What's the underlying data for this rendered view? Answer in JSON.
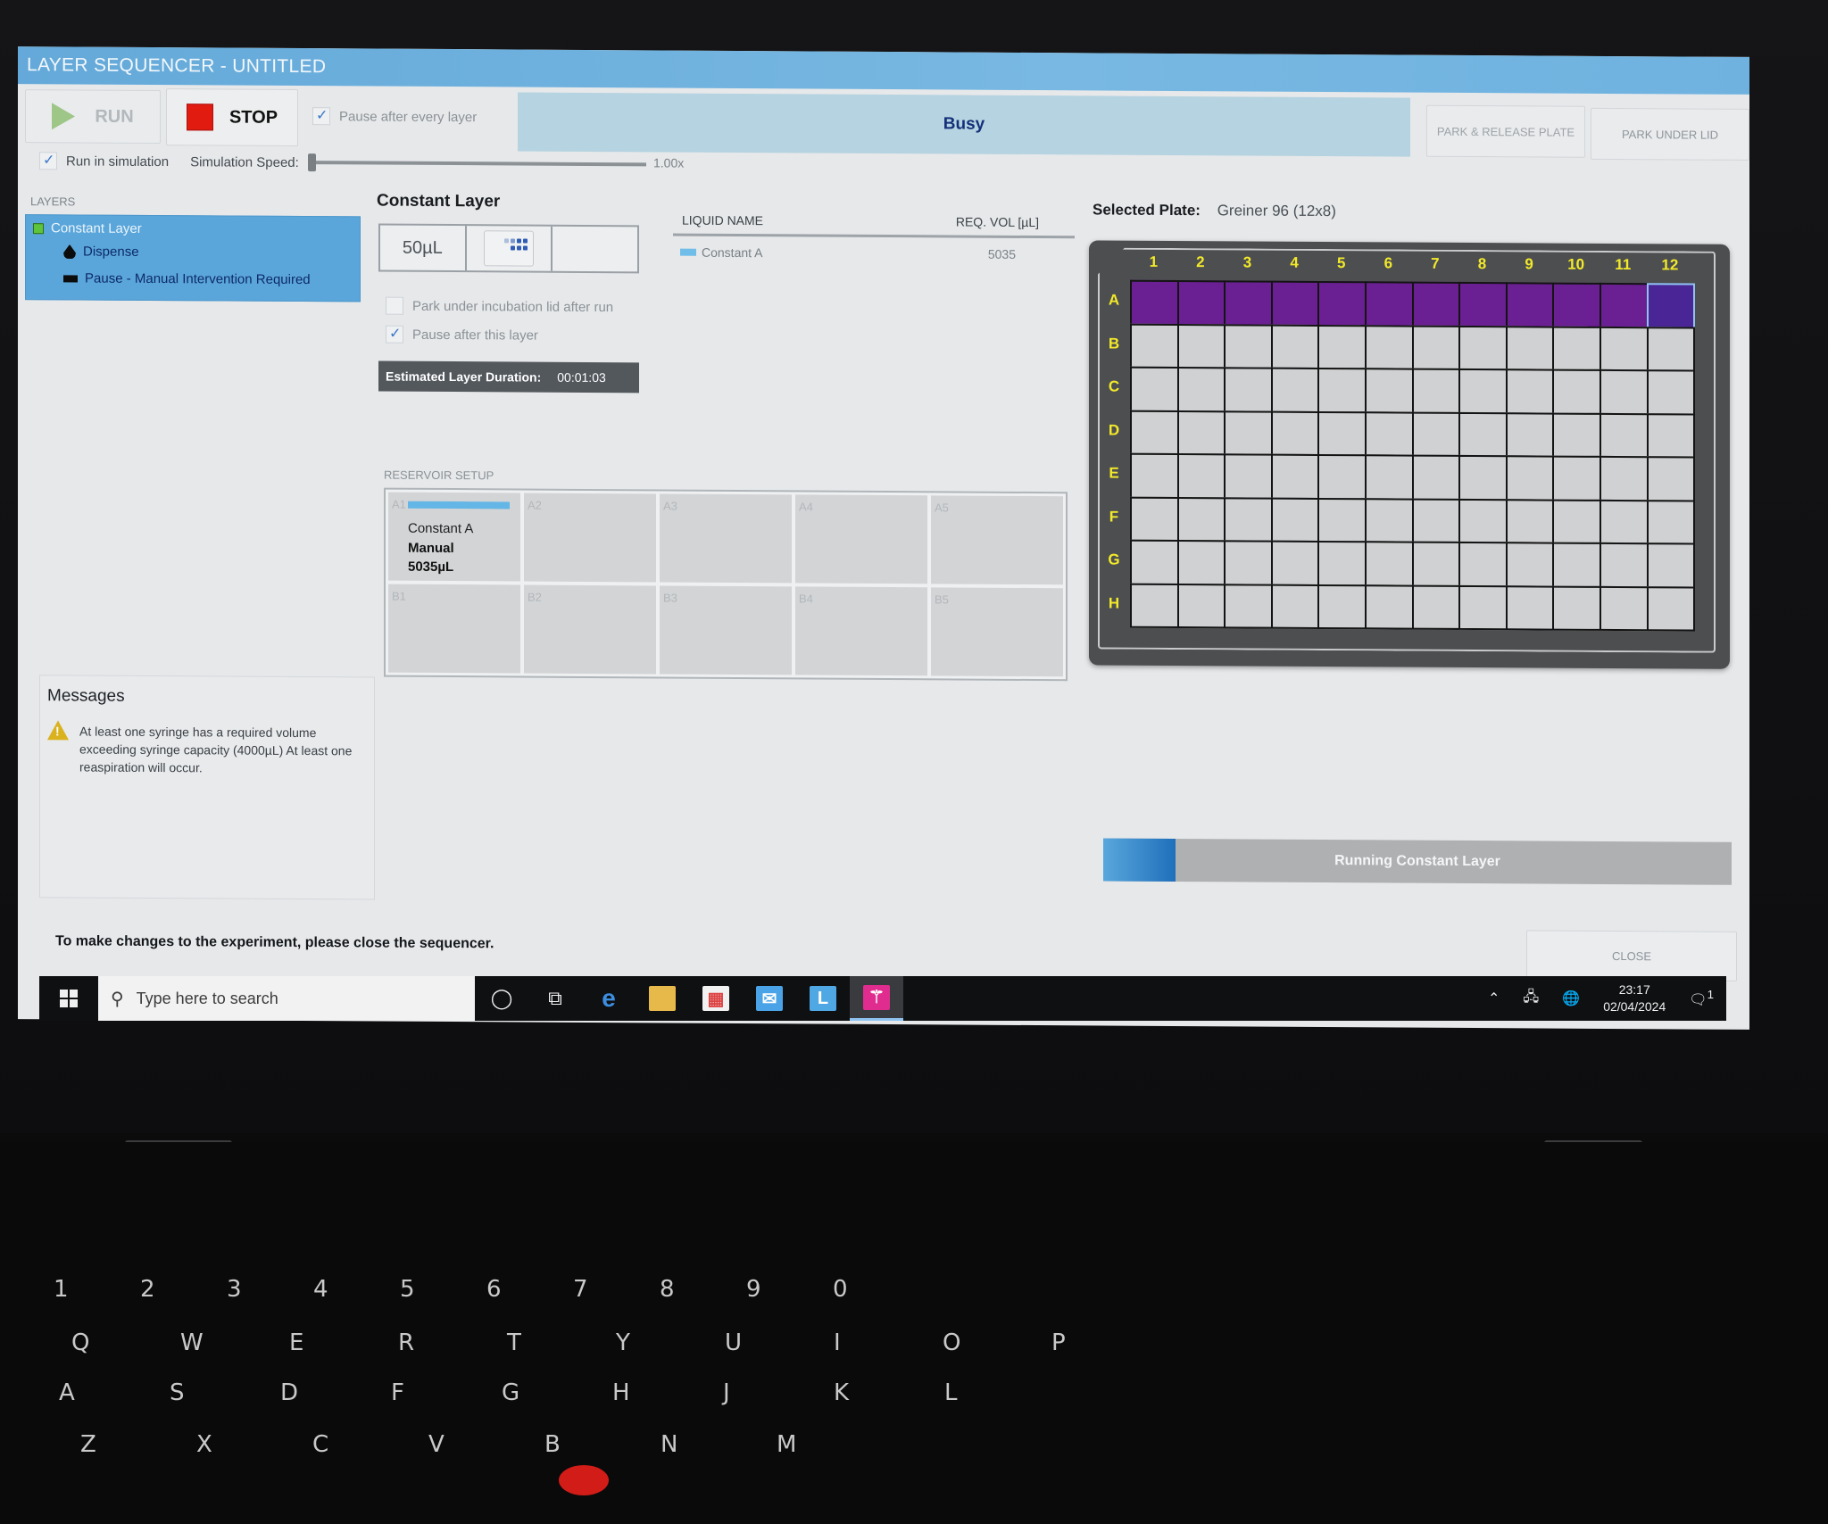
{
  "window": {
    "title": "LAYER SEQUENCER - UNTITLED"
  },
  "toolbar": {
    "run_label": "RUN",
    "stop_label": "STOP",
    "pause_every_layer": {
      "label": "Pause after every layer",
      "checked": true
    },
    "status": "Busy",
    "park_release_label": "PARK & RELEASE PLATE",
    "park_lid_label": "PARK UNDER LID"
  },
  "simulation": {
    "run_in_simulation": {
      "label": "Run in simulation",
      "checked": true
    },
    "speed_label": "Simulation Speed:",
    "speed_value": "1.00x",
    "speed_fraction": 0.0
  },
  "layers": {
    "heading": "LAYERS",
    "items": [
      {
        "label": "Constant Layer",
        "icon": "green-square-icon"
      },
      {
        "label": "Dispense",
        "icon": "drop-icon"
      },
      {
        "label": "Pause - Manual Intervention Required",
        "icon": "pause-bar-icon"
      }
    ]
  },
  "layer_detail": {
    "title": "Constant Layer",
    "volume_tile": "50µL",
    "options": [
      {
        "label": "Park under incubation lid after run",
        "checked": false
      },
      {
        "label": "Pause after this layer",
        "checked": true
      }
    ],
    "estimated_duration_label": "Estimated Layer Duration:",
    "estimated_duration_value": "00:01:03"
  },
  "liquids": {
    "columns": [
      "LIQUID NAME",
      "REQ. VOL [µL]"
    ],
    "rows": [
      {
        "name": "Constant A",
        "volume": "5035",
        "color": "#6fbde8"
      }
    ]
  },
  "reservoir": {
    "heading": "RESERVOIR SETUP",
    "cells": [
      {
        "id": "A1",
        "liquid": "Constant A",
        "mode": "Manual",
        "volume": "5035µL"
      },
      {
        "id": "A2"
      },
      {
        "id": "A3"
      },
      {
        "id": "A4"
      },
      {
        "id": "A5"
      },
      {
        "id": "B1"
      },
      {
        "id": "B2"
      },
      {
        "id": "B3"
      },
      {
        "id": "B4"
      },
      {
        "id": "B5"
      }
    ]
  },
  "messages": {
    "heading": "Messages",
    "items": [
      {
        "level": "warning",
        "text": "At least one syringe has a required volume exceeding syringe capacity (4000µL) At least one reaspiration will occur."
      }
    ]
  },
  "plate": {
    "label": "Selected Plate:",
    "name": "Greiner 96  (12x8)",
    "columns": [
      "1",
      "2",
      "3",
      "4",
      "5",
      "6",
      "7",
      "8",
      "9",
      "10",
      "11",
      "12"
    ],
    "rows": [
      "A",
      "B",
      "C",
      "D",
      "E",
      "F",
      "G",
      "H"
    ],
    "filled_row": "A",
    "selected_well": "A12",
    "fill_color": "#6a1f93",
    "label_color": "#f2e92a"
  },
  "progress": {
    "label": "Running Constant Layer",
    "fraction": 0.115
  },
  "close_label": "CLOSE",
  "footer_note": "To make changes to the experiment, please close the sequencer.",
  "taskbar": {
    "search_placeholder": "Type here to search",
    "apps": [
      "cortana-icon",
      "task-view-icon",
      "edge-icon",
      "file-explorer-icon",
      "store-icon",
      "mail-icon",
      "l-app-icon",
      "sequencer-app-icon"
    ],
    "time": "23:17",
    "date": "02/04/2024",
    "notifications": "1"
  }
}
